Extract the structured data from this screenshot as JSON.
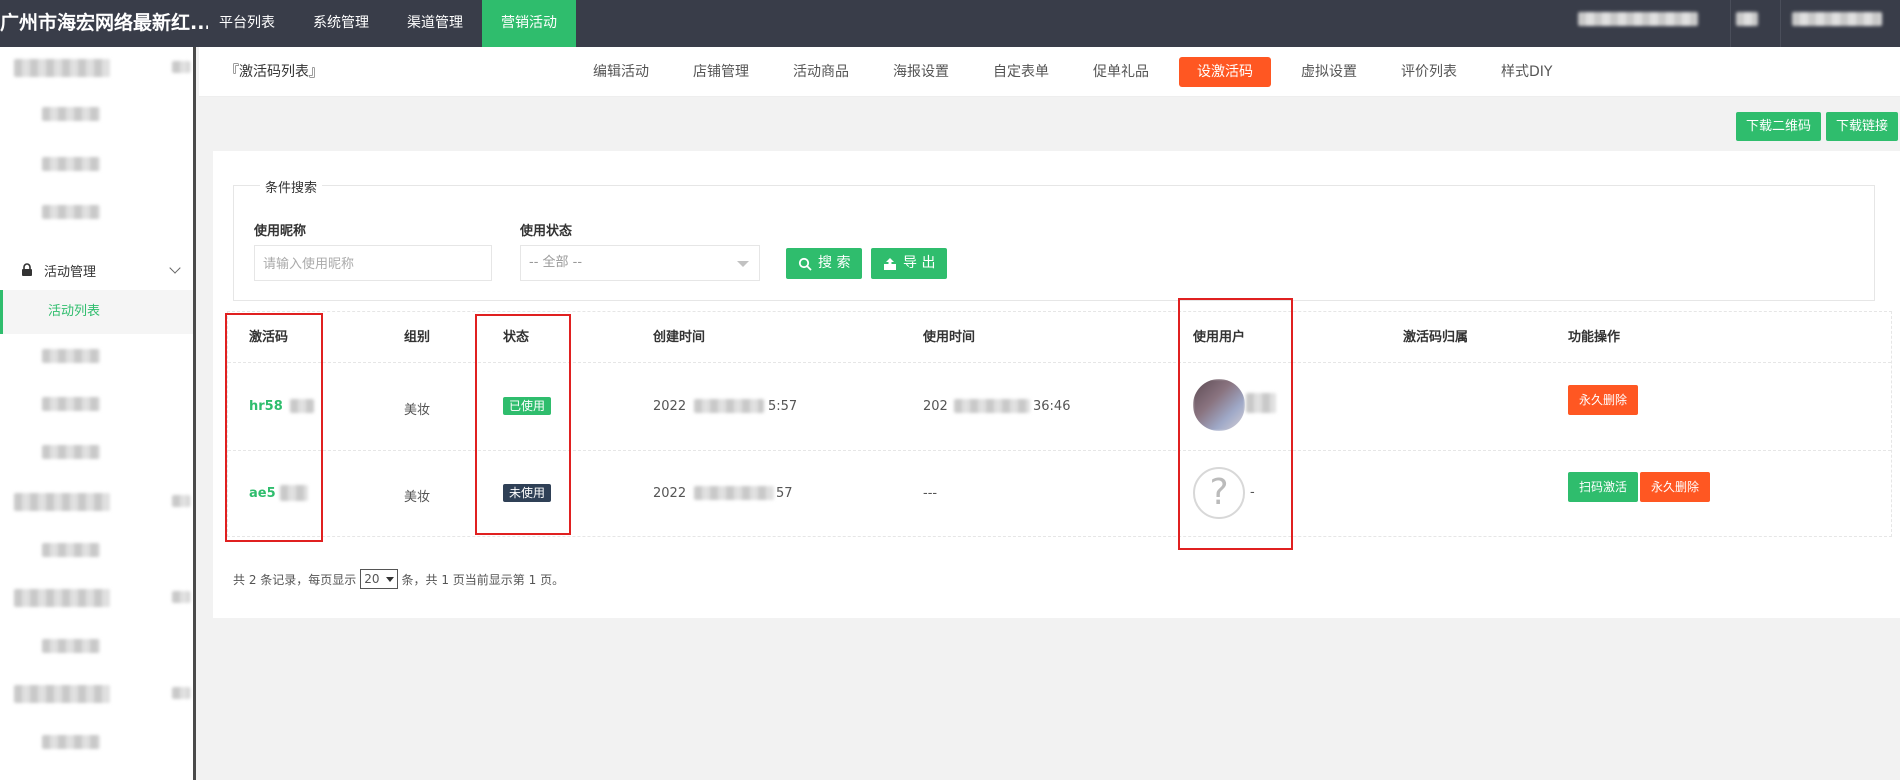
{
  "brand": "广州市海宏网络最新红...",
  "topnav": [
    "平台列表",
    "系统管理",
    "渠道管理",
    "营销活动"
  ],
  "sidebar": {
    "group_label": "活动管理",
    "active_item": "活动列表"
  },
  "tabbar": {
    "title": "『激活码列表』",
    "tabs": [
      "编辑活动",
      "店铺管理",
      "活动商品",
      "海报设置",
      "自定表单",
      "促单礼品",
      "设激活码",
      "虚拟设置",
      "评价列表",
      "样式DIY"
    ],
    "active_index": 6
  },
  "actions": {
    "download_qr": "下载二维码",
    "download_link": "下载链接"
  },
  "search": {
    "legend": "条件搜索",
    "nickname_label": "使用昵称",
    "nickname_placeholder": "请输入使用昵称",
    "status_label": "使用状态",
    "status_selected": "-- 全部 --",
    "search_btn": "搜 索",
    "export_btn": "导 出"
  },
  "table": {
    "headers": [
      "激活码",
      "组别",
      "状态",
      "创建时间",
      "使用时间",
      "使用用户",
      "激活码归属",
      "功能操作"
    ],
    "rows": [
      {
        "code": "hr58",
        "group": "美妆",
        "status": "已使用",
        "created": "2022",
        "created_tail": "5:57",
        "used": "202",
        "used_tail": "36:46",
        "user": "",
        "owner": "",
        "actions": [
          "永久删除"
        ]
      },
      {
        "code": "ae5",
        "group": "美妆",
        "status": "未使用",
        "created": "2022",
        "created_tail": "57",
        "used": "---",
        "used_tail": "",
        "user": "-",
        "owner": "",
        "actions": [
          "扫码激活",
          "永久删除"
        ]
      }
    ]
  },
  "pager": {
    "prefix": "共 2 条记录，每页显示",
    "per_page": "20",
    "suffix": "条，共 1 页当前显示第 1 页。"
  },
  "colors": {
    "nav_bg": "#393d49",
    "accent_green": "#2fbd6d",
    "accent_orange": "#ff5722",
    "badge_dark": "#2f4056",
    "annotation_red": "#e02020"
  }
}
